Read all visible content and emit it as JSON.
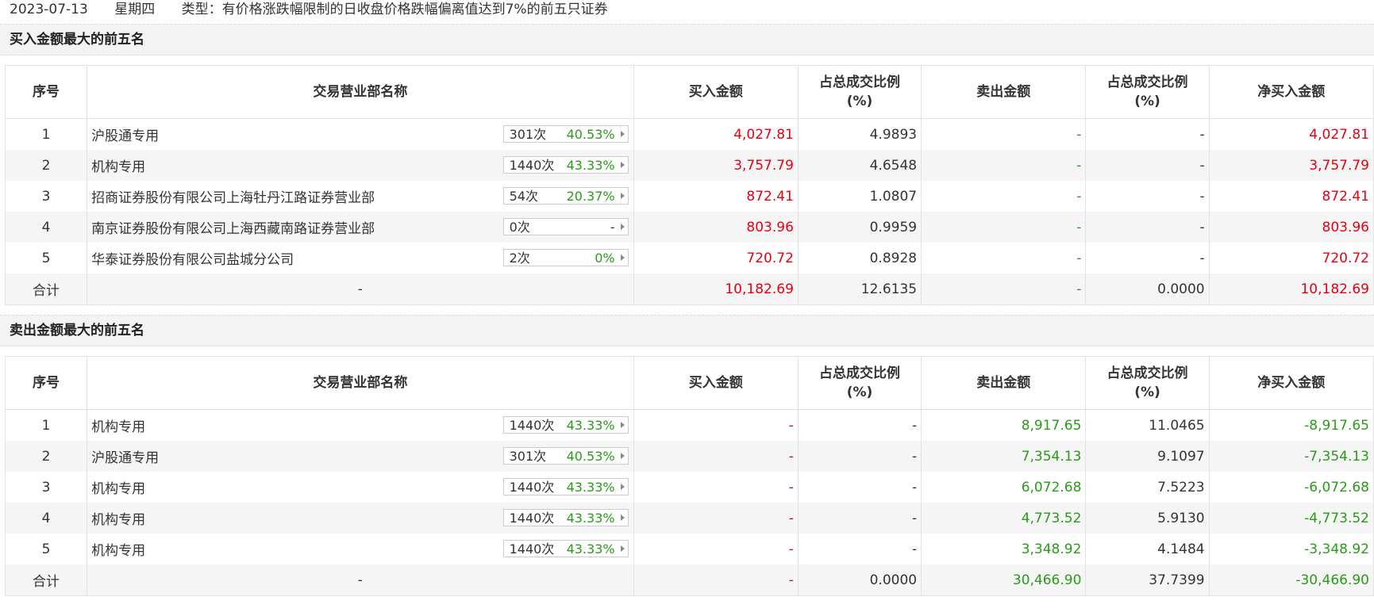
{
  "header": {
    "date": "2023-07-13",
    "weekday": "星期四",
    "type_text": "类型：有价格涨跌幅限制的日收盘价格跌幅偏离值达到7%的前五只证券"
  },
  "columns": {
    "idx": "序号",
    "name": "交易营业部名称",
    "buy": "买入金额",
    "buy_ratio_1": "占总成交比例",
    "buy_ratio_2": "(%)",
    "sell": "卖出金额",
    "sell_ratio_1": "占总成交比例",
    "sell_ratio_2": "(%)",
    "net": "净买入金额"
  },
  "buy_section": {
    "title": "买入金额最大的前五名",
    "rows": [
      {
        "idx": "1",
        "name": "沪股通专用",
        "times": "301次",
        "pct": "40.53%",
        "buy": "4,027.81",
        "buy_ratio": "4.9893",
        "sell": "-",
        "sell_ratio": "-",
        "net": "4,027.81"
      },
      {
        "idx": "2",
        "name": "机构专用",
        "times": "1440次",
        "pct": "43.33%",
        "buy": "3,757.79",
        "buy_ratio": "4.6548",
        "sell": "-",
        "sell_ratio": "-",
        "net": "3,757.79"
      },
      {
        "idx": "3",
        "name": "招商证券股份有限公司上海牡丹江路证券营业部",
        "times": "54次",
        "pct": "20.37%",
        "buy": "872.41",
        "buy_ratio": "1.0807",
        "sell": "-",
        "sell_ratio": "-",
        "net": "872.41"
      },
      {
        "idx": "4",
        "name": "南京证券股份有限公司上海西藏南路证券营业部",
        "times": "0次",
        "pct": "-",
        "buy": "803.96",
        "buy_ratio": "0.9959",
        "sell": "-",
        "sell_ratio": "-",
        "net": "803.96"
      },
      {
        "idx": "5",
        "name": "华泰证券股份有限公司盐城分公司",
        "times": "2次",
        "pct": "0%",
        "buy": "720.72",
        "buy_ratio": "0.8928",
        "sell": "-",
        "sell_ratio": "-",
        "net": "720.72"
      }
    ],
    "total": {
      "label": "合计",
      "name": "-",
      "buy": "10,182.69",
      "buy_ratio": "12.6135",
      "sell": "-",
      "sell_ratio": "0.0000",
      "net": "10,182.69"
    }
  },
  "sell_section": {
    "title": "卖出金额最大的前五名",
    "rows": [
      {
        "idx": "1",
        "name": "机构专用",
        "times": "1440次",
        "pct": "43.33%",
        "buy": "-",
        "buy_ratio": "-",
        "sell": "8,917.65",
        "sell_ratio": "11.0465",
        "net": "-8,917.65"
      },
      {
        "idx": "2",
        "name": "沪股通专用",
        "times": "301次",
        "pct": "40.53%",
        "buy": "-",
        "buy_ratio": "-",
        "sell": "7,354.13",
        "sell_ratio": "9.1097",
        "net": "-7,354.13"
      },
      {
        "idx": "3",
        "name": "机构专用",
        "times": "1440次",
        "pct": "43.33%",
        "buy": "-",
        "buy_ratio": "-",
        "sell": "6,072.68",
        "sell_ratio": "7.5223",
        "net": "-6,072.68"
      },
      {
        "idx": "4",
        "name": "机构专用",
        "times": "1440次",
        "pct": "43.33%",
        "buy": "-",
        "buy_ratio": "-",
        "sell": "4,773.52",
        "sell_ratio": "5.9130",
        "net": "-4,773.52"
      },
      {
        "idx": "5",
        "name": "机构专用",
        "times": "1440次",
        "pct": "43.33%",
        "buy": "-",
        "buy_ratio": "-",
        "sell": "3,348.92",
        "sell_ratio": "4.1484",
        "net": "-3,348.92"
      }
    ],
    "total": {
      "label": "合计",
      "name": "-",
      "buy": "-",
      "buy_ratio": "0.0000",
      "sell": "30,466.90",
      "sell_ratio": "37.7399",
      "net": "-30,466.90"
    }
  },
  "colors": {
    "up": "#e60012",
    "down": "#2a9a1a",
    "text": "#333333",
    "row_alt": "#f5f5f5"
  }
}
